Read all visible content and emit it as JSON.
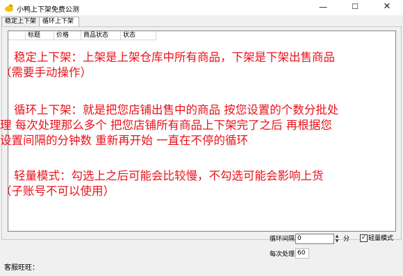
{
  "window": {
    "title": "小鸭上下架免费公测",
    "minimize": "—",
    "maximize": "☐",
    "close": "✕"
  },
  "tabs": [
    {
      "label": "稳定上下架"
    },
    {
      "label": "循环上下架"
    }
  ],
  "table": {
    "columns": [
      "",
      "标题",
      "价格",
      "商品状态",
      "状态"
    ]
  },
  "notes": {
    "p1a": "稳定上下架：上架是上架仓库中所有商品，下架是下架出售商品",
    "p1b": "（需要手动操作）",
    "p2a": "循环上下架：就是把您店铺出售中的商品 按您设置的个数分批处",
    "p2b": "理 每次处理那么多个 把您店铺所有商品上下架完了之后 再根据您",
    "p2c": "设置间隔的分钟数 重新再开始 一直在不停的循环",
    "p3a": "轻量模式：勾选上之后可能会比较慢，不勾选可能会影响上货",
    "p3b": "（子账号不可以使用）"
  },
  "controls": {
    "interval_label": "循环间隔",
    "interval_value": "0",
    "interval_unit": "分",
    "light_mode_label": "轻量模式",
    "light_mode_checked": "✓",
    "batch_label": "每次处理",
    "batch_value": "60"
  },
  "footer": {
    "service_label": "客服旺旺："
  },
  "icons": {
    "app": "duck-icon",
    "spin_up": "▲",
    "spin_down": "▼"
  }
}
